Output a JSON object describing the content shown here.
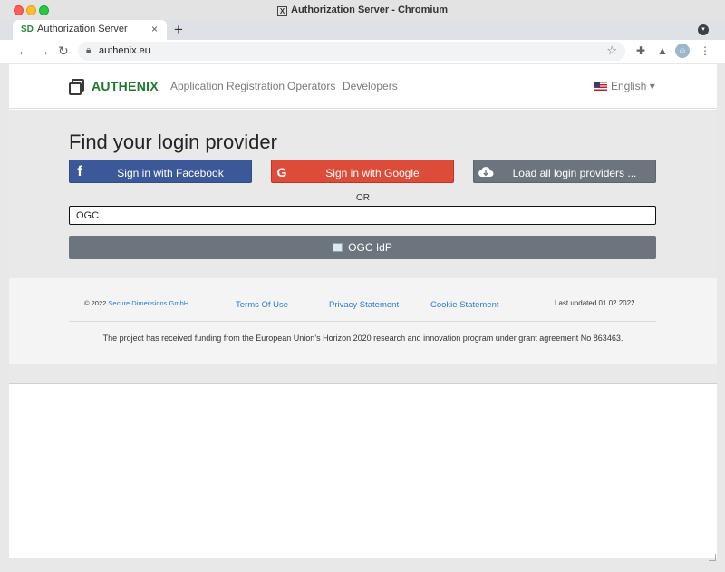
{
  "window": {
    "title": "Authorization Server - Chromium"
  },
  "tabs": [
    {
      "title": "Authorization Server"
    }
  ],
  "address_bar": {
    "url": "authenix.eu"
  },
  "navbar": {
    "brand": "AUTHENIX",
    "links": [
      "Application Registration",
      "Operators",
      "Developers"
    ],
    "language": "English"
  },
  "hero": {
    "title": "Find your login provider",
    "buttons": {
      "facebook": "Sign in with Facebook",
      "google": "Sign in with Google",
      "load_all": "Load all login providers ..."
    },
    "separator": "OR",
    "search_value": "OGC",
    "result_button": "OGC IdP"
  },
  "footer": {
    "copyright_prefix": "© 2022",
    "company": "Secure Dimensions GmbH",
    "links": [
      "Terms Of Use",
      "Privacy Statement",
      "Cookie Statement"
    ],
    "last_updated": "Last updated 01.02.2022",
    "funding": "The project has received funding from the European Union’s Horizon 2020 research and innovation program under grant agreement No 863463."
  },
  "colors": {
    "brand_green": "#1c7a2c",
    "facebook": "#3b5998",
    "google": "#dd4b39",
    "secondary": "#6c757d",
    "link_blue": "#2d7ad6"
  }
}
